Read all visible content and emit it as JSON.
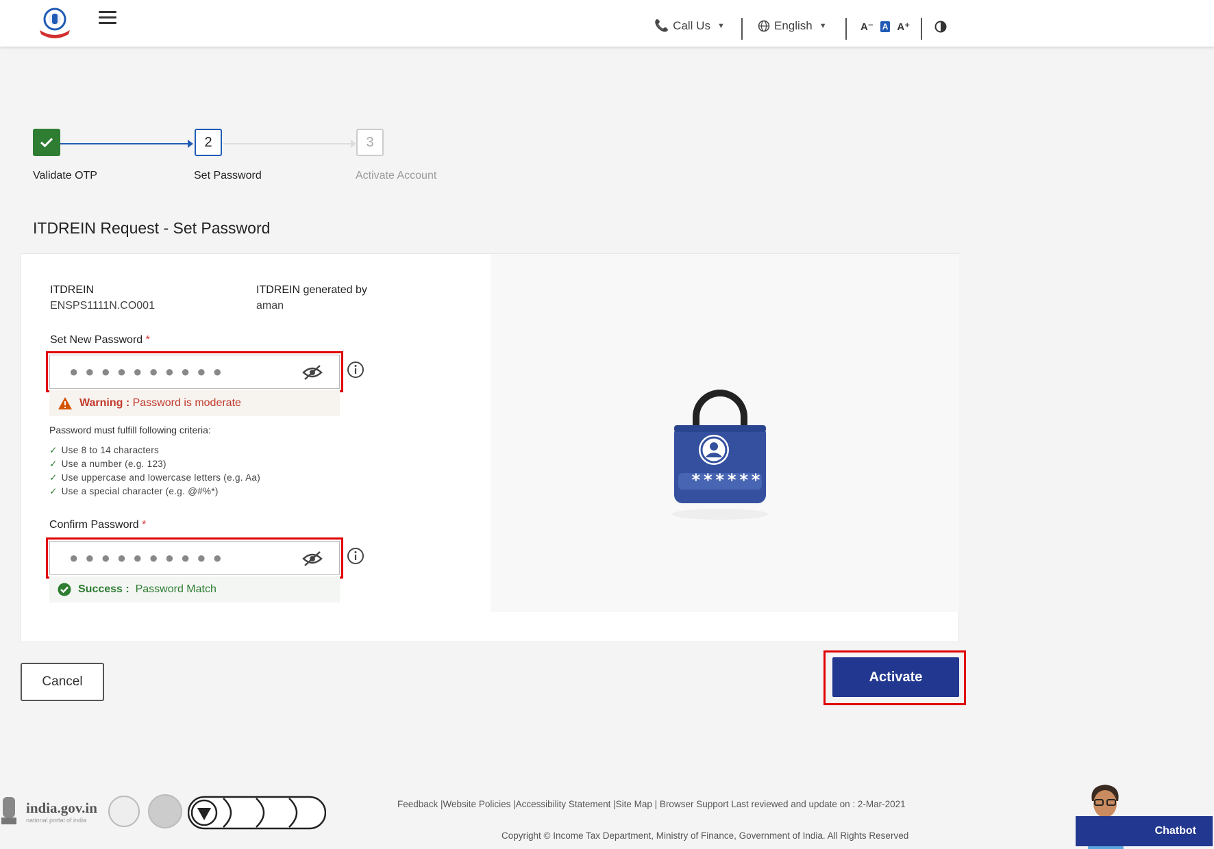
{
  "header": {
    "call_us": "Call Us",
    "language": "English",
    "font_small": "A⁻",
    "font_normal": "A",
    "font_large": "A⁺"
  },
  "stepper": {
    "steps": [
      {
        "number": "✓",
        "label": "Validate OTP",
        "state": "done"
      },
      {
        "number": "2",
        "label": "Set Password",
        "state": "active"
      },
      {
        "number": "3",
        "label": "Activate Account",
        "state": "todo"
      }
    ]
  },
  "page_title": "ITDREIN Request - Set Password",
  "form": {
    "itdrein_label": "ITDREIN",
    "itdrein_value": "ENSPS1111N.CO001",
    "generated_by_label": "ITDREIN generated by",
    "generated_by_value": "aman",
    "new_password_label": "Set New Password",
    "new_password_dots": "●●●●●●●●●●",
    "warning_prefix": "Warning :",
    "warning_text": "Password is moderate",
    "criteria_head": "Password must fulfill following criteria:",
    "criteria": [
      "Use 8 to 14 characters",
      "Use a number (e.g. 123)",
      "Use uppercase and lowercase letters (e.g. Aa)",
      "Use a special character (e.g. @#%*)"
    ],
    "confirm_password_label": "Confirm Password",
    "confirm_password_dots": "●●●●●●●●●●",
    "success_prefix": "Success :",
    "success_text": "Password Match",
    "required_mark": "*"
  },
  "illustration": {
    "lock_mask": "******"
  },
  "buttons": {
    "cancel": "Cancel",
    "activate": "Activate"
  },
  "footer": {
    "india_gov": "india.gov.in",
    "india_gov_tagline": "national portal of india",
    "links": "Feedback |Website Policies |Accessibility Statement |Site Map | Browser Support   Last reviewed and update on : 2-Mar-2021",
    "copyright": "Copyright © Income Tax Department, Ministry of Finance, Government of India. All Rights Reserved",
    "chatbot": "Chatbot"
  },
  "colors": {
    "primary": "#22378f",
    "success": "#2e7d32",
    "warning": "#c0392b",
    "highlight": "#e00000"
  }
}
